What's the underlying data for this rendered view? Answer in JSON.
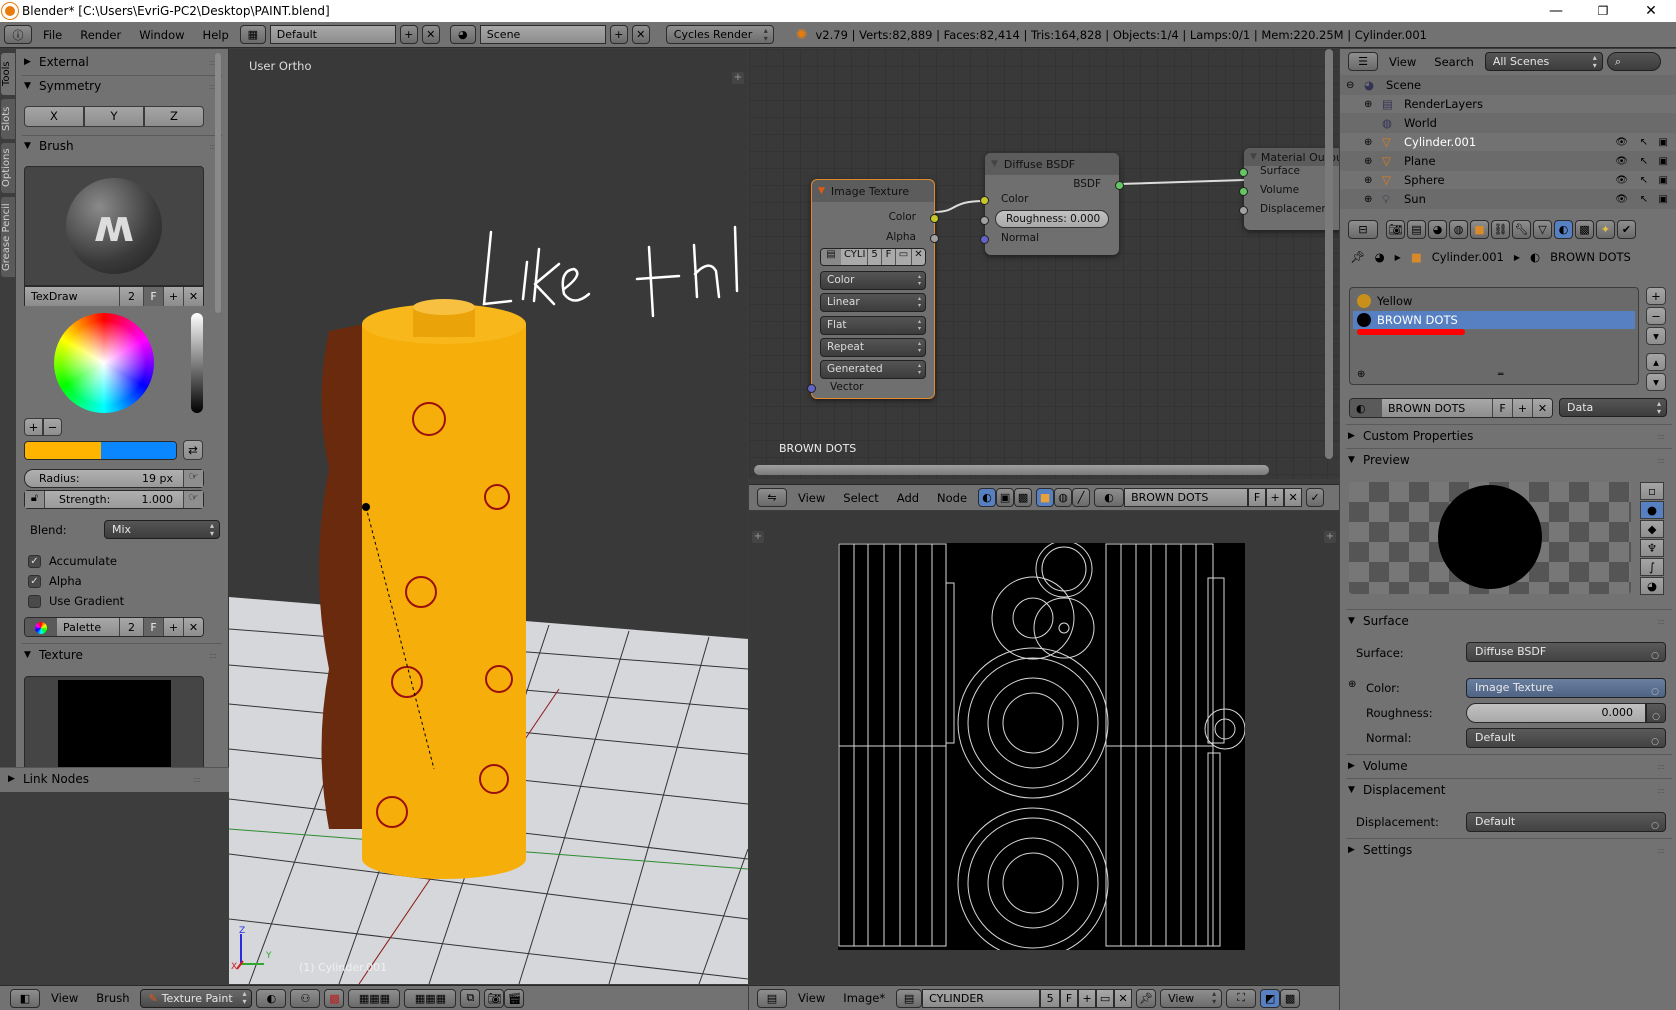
{
  "window": {
    "title": "Blender* [C:\\Users\\EvriG-PC2\\Desktop\\PAINT.blend]",
    "minimize": "—",
    "maximize": "❐",
    "close": "✕"
  },
  "topbar": {
    "menus": [
      "File",
      "Render",
      "Window",
      "Help"
    ],
    "layout": "Default",
    "scene": "Scene",
    "engine": "Cycles Render",
    "status": "v2.79 | Verts:82,889 | Faces:82,414 | Tris:164,828 | Objects:1/4 | Lamps:0/1 | Mem:220.25M | Cylinder.001"
  },
  "tool_tabs": [
    "Tools",
    "Slots",
    "Options",
    "Grease Pencil"
  ],
  "tool_shelf": {
    "external": "External",
    "symmetry": {
      "title": "Symmetry",
      "axes": [
        "X",
        "Y",
        "Z"
      ]
    },
    "brush": {
      "title": "Brush",
      "name": "TexDraw",
      "users": "2",
      "fake": "F",
      "primary_color": "#ffb400",
      "secondary_color": "#0a87ff",
      "radius_label": "Radius:",
      "radius_value": "19 px",
      "strength_label": "Strength:",
      "strength_value": "1.000",
      "blend_label": "Blend:",
      "blend_value": "Mix",
      "accumulate": {
        "label": "Accumulate",
        "checked": true
      },
      "alpha": {
        "label": "Alpha",
        "checked": true
      },
      "use_gradient": {
        "label": "Use Gradient",
        "checked": false
      },
      "palette": "Palette",
      "palette_users": "2",
      "palette_fake": "F"
    },
    "texture": "Texture",
    "link_nodes": "Link Nodes"
  },
  "viewport": {
    "view_name": "User Ortho",
    "annotation": "Like this!",
    "object_label": "(1) Cylinder.001",
    "axis_x": "X",
    "axis_y": "Y",
    "axis_z": "Z"
  },
  "node_editor": {
    "material_label": "BROWN DOTS",
    "image_texture": {
      "title": "Image Texture",
      "out_color": "Color",
      "out_alpha": "Alpha",
      "image": "CYLI",
      "users": "5",
      "fake": "F",
      "options": [
        "Color",
        "Linear",
        "Flat",
        "Repeat",
        "Generated"
      ],
      "in_vector": "Vector"
    },
    "diffuse": {
      "title": "Diffuse BSDF",
      "out": "BSDF",
      "in_color": "Color",
      "roughness": "Roughness:  0.000",
      "in_normal": "Normal"
    },
    "output": {
      "title": "Material Output",
      "inputs": [
        "Surface",
        "Volume",
        "Displacement"
      ]
    },
    "header": {
      "menus": [
        "View",
        "Select",
        "Add",
        "Node"
      ],
      "material": "BROWN DOTS",
      "fake": "F"
    }
  },
  "outliner": {
    "menus": [
      "View",
      "Search"
    ],
    "filter": "All Scenes",
    "rows": [
      {
        "name": "Scene",
        "indent": 0
      },
      {
        "name": "RenderLayers",
        "indent": 1
      },
      {
        "name": "World",
        "indent": 1
      },
      {
        "name": "Cylinder.001",
        "indent": 1
      },
      {
        "name": "Plane",
        "indent": 1
      },
      {
        "name": "Sphere",
        "indent": 1
      },
      {
        "name": "Sun",
        "indent": 1
      }
    ]
  },
  "properties": {
    "breadcrumb": [
      "Cylinder.001",
      "BROWN DOTS"
    ],
    "slots": [
      {
        "name": "Yellow",
        "color": "#c8901a",
        "selected": false
      },
      {
        "name": "BROWN DOTS",
        "color": "#000000",
        "selected": true
      }
    ],
    "material_name": "BROWN DOTS",
    "fake": "F",
    "link": "Data",
    "custom_properties": "Custom Properties",
    "preview": "Preview",
    "surface": {
      "title": "Surface",
      "surface_label": "Surface:",
      "surface_value": "Diffuse BSDF",
      "color_label": "Color:",
      "color_value": "Image Texture",
      "roughness_label": "Roughness:",
      "roughness_value": "0.000",
      "normal_label": "Normal:",
      "normal_value": "Default"
    },
    "volume": "Volume",
    "displacement": {
      "title": "Displacement",
      "label": "Displacement:",
      "value": "Default"
    },
    "settings": "Settings"
  },
  "bottom_3d": {
    "menus": [
      "View",
      "Brush"
    ],
    "mode": "Texture Paint"
  },
  "bottom_uv": {
    "menus": [
      "View",
      "Image*"
    ],
    "image": "CYLINDER",
    "users": "5",
    "fake": "F",
    "view": "View"
  }
}
